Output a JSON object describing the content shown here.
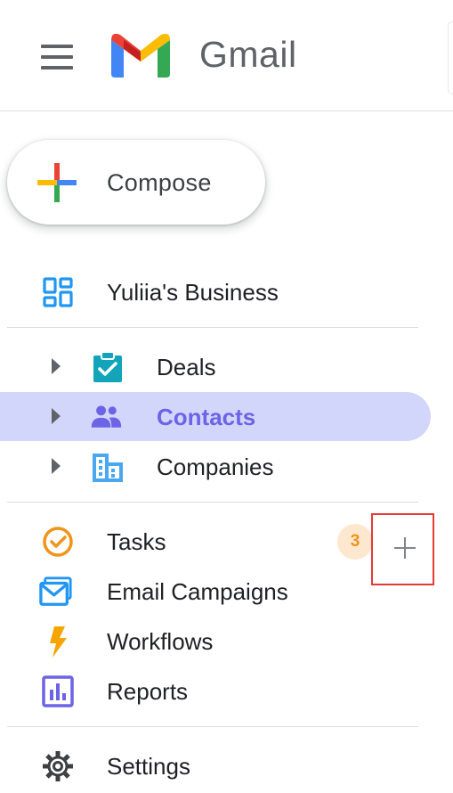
{
  "header": {
    "app_name": "Gmail",
    "menu_icon": "hamburger-menu-icon",
    "logo_icon": "gmail-logo-icon"
  },
  "compose": {
    "label": "Compose",
    "icon": "plus-icon"
  },
  "workspace": {
    "label": "Yuliia's Business",
    "icon": "dashboard-grid-icon"
  },
  "crm_items": [
    {
      "label": "Deals",
      "icon": "clipboard-check-icon",
      "color": "#12a4b8"
    },
    {
      "label": "Contacts",
      "icon": "people-icon",
      "color": "#6c63e6",
      "active": true
    },
    {
      "label": "Companies",
      "icon": "building-icon",
      "color": "#4aa8f0"
    }
  ],
  "tools": [
    {
      "label": "Tasks",
      "icon": "check-circle-icon",
      "badge": "3",
      "color": "#f0941c"
    },
    {
      "label": "Email Campaigns",
      "icon": "mail-icon",
      "color": "#2196f3"
    },
    {
      "label": "Workflows",
      "icon": "lightning-icon",
      "color": "#f5a400"
    },
    {
      "label": "Reports",
      "icon": "bar-chart-icon",
      "color": "#6c63e6"
    }
  ],
  "settings": {
    "label": "Settings",
    "icon": "gear-icon"
  },
  "colors": {
    "active_bg": "#d3d6fb",
    "active_text": "#6c63e6",
    "highlight_border": "#e53935"
  }
}
